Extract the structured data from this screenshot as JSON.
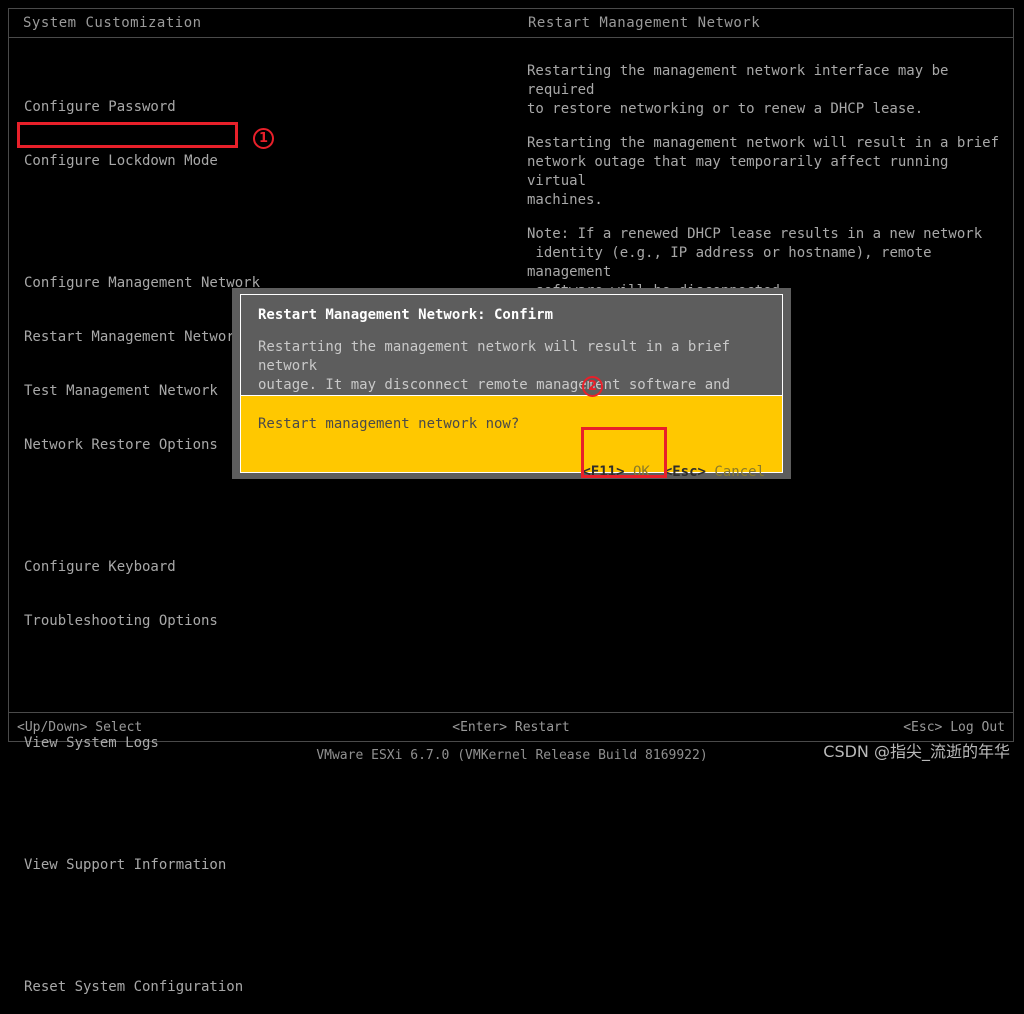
{
  "screen": {
    "left_title": "System Customization",
    "right_title": "Restart Management Network"
  },
  "menu": {
    "groups": [
      {
        "items": [
          {
            "label": "Configure Password",
            "selected": false
          },
          {
            "label": "Configure Lockdown Mode",
            "selected": false
          }
        ]
      },
      {
        "items": [
          {
            "label": "Configure Management Network",
            "selected": false
          },
          {
            "label": "Restart Management Network",
            "selected": true
          },
          {
            "label": "Test Management Network",
            "selected": false
          },
          {
            "label": "Network Restore Options",
            "selected": false
          }
        ]
      },
      {
        "items": [
          {
            "label": "Configure Keyboard",
            "selected": false
          },
          {
            "label": "Troubleshooting Options",
            "selected": false
          }
        ]
      },
      {
        "items": [
          {
            "label": "View System Logs",
            "selected": false
          }
        ]
      },
      {
        "items": [
          {
            "label": "View Support Information",
            "selected": false
          }
        ]
      },
      {
        "items": [
          {
            "label": "Reset System Configuration",
            "selected": false
          }
        ]
      }
    ]
  },
  "description": {
    "paragraphs": [
      "Restarting the management network interface may be required\nto restore networking or to renew a DHCP lease.",
      "Restarting the management network will result in a brief\nnetwork outage that may temporarily affect running virtual\nmachines.",
      "Note: If a renewed DHCP lease results in a new network\n identity (e.g., IP address or hostname), remote management\n software will be disconnected."
    ]
  },
  "dialog": {
    "title": "Restart Management Network: Confirm",
    "body": "Restarting the management network will result in a brief network\noutage. It may disconnect remote management software and affect\nrunning virtual machines.",
    "question": "Restart management network now?",
    "actions": [
      {
        "key": "<F11>",
        "label": "OK",
        "name": "ok"
      },
      {
        "key": "<Esc>",
        "label": "Cancel",
        "name": "cancel"
      }
    ]
  },
  "status_bar": {
    "left_key": "<Up/Down>",
    "left_label": "Select",
    "center_key": "<Enter>",
    "center_label": "Restart",
    "right_key": "<Esc>",
    "right_label": "Log Out"
  },
  "footer": {
    "version": "VMware ESXi 6.7.0 (VMKernel Release Build 8169922)"
  },
  "watermark": {
    "text": "CSDN @指尖_流逝的年华"
  },
  "annotations": {
    "color": "#e8202a",
    "markers": [
      {
        "id": "1",
        "glyph": "①",
        "target": "Restart Management Network menu item"
      },
      {
        "id": "2",
        "glyph": "②",
        "target": "<F11> OK confirm button"
      }
    ]
  }
}
